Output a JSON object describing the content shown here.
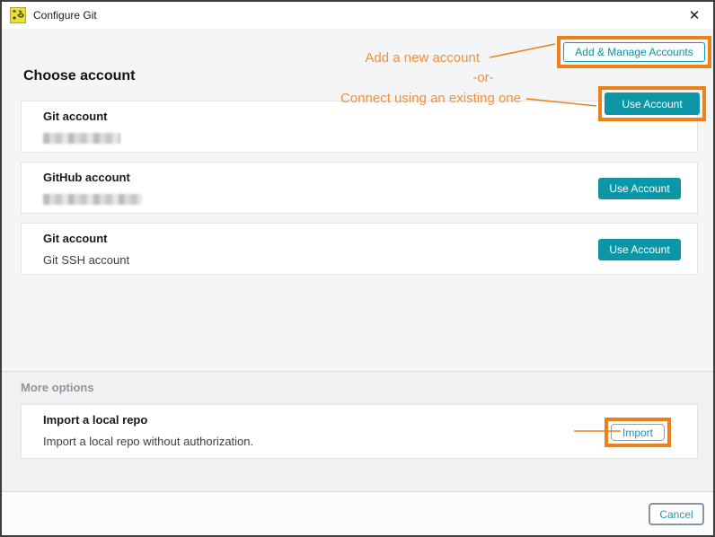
{
  "window": {
    "title": "Configure Git",
    "close_glyph": "✕"
  },
  "colors": {
    "teal": "#0d96a6",
    "highlight_orange": "#ee8019",
    "annotation_orange": "#f68f35",
    "section_bg": "#f4f5f6"
  },
  "main": {
    "heading": "Choose account",
    "add_manage_button": "Add & Manage Accounts",
    "accounts": [
      {
        "title": "Git account",
        "subtitle_redacted": true,
        "action": "Use Account",
        "highlighted": true
      },
      {
        "title": "GitHub account",
        "subtitle_redacted": true,
        "action": "Use Account",
        "highlighted": false
      },
      {
        "title": "Git account",
        "subtitle": "Git SSH account",
        "action": "Use Account",
        "highlighted": false
      }
    ],
    "annotations": {
      "add_new": "Add a new account",
      "or": "-or-",
      "connect_existing": "Connect using an existing one",
      "import_repo": "Import a local repo"
    }
  },
  "more_options": {
    "heading": "More options",
    "card": {
      "title": "Import a local repo",
      "description": "Import a local repo without authorization.",
      "action": "Import"
    }
  },
  "footer": {
    "cancel": "Cancel"
  }
}
